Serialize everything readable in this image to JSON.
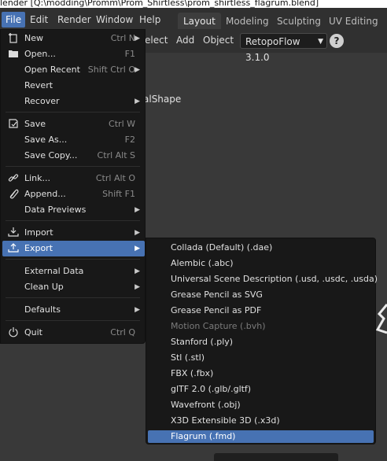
{
  "window": {
    "title": "lender [Q:\\modding\\Promm\\Prom_Shirtless\\prom_shirtless_flagrum.blend]"
  },
  "topbar": {
    "menus": [
      "File",
      "Edit",
      "Render",
      "Window",
      "Help"
    ],
    "workspaces": [
      "Layout",
      "Modeling",
      "Sculpting",
      "UV Editing"
    ]
  },
  "viewport_header": {
    "items": [
      "elect",
      "Add",
      "Object"
    ],
    "addon_dropdown": "RetopoFlow 3.1.0",
    "help_glyph": "?"
  },
  "viewport": {
    "object_label": "alShape"
  },
  "file_menu": {
    "items": [
      {
        "label": "New",
        "shortcut": "Ctrl N",
        "icon": "new-file-icon",
        "submenu": true
      },
      {
        "label": "Open...",
        "shortcut": "F1",
        "icon": "folder-icon"
      },
      {
        "label": "Open Recent",
        "shortcut": "Shift Ctrl O",
        "submenu": true
      },
      {
        "label": "Revert",
        "shortcut": ""
      },
      {
        "label": "Recover",
        "shortcut": "",
        "submenu": true
      },
      {
        "label": "Save",
        "shortcut": "Ctrl W",
        "icon": "save-icon"
      },
      {
        "label": "Save As...",
        "shortcut": "F2"
      },
      {
        "label": "Save Copy...",
        "shortcut": "Ctrl Alt S"
      },
      {
        "label": "Link...",
        "shortcut": "Ctrl Alt O",
        "icon": "link-icon"
      },
      {
        "label": "Append...",
        "shortcut": "Shift F1",
        "icon": "append-icon"
      },
      {
        "label": "Data Previews",
        "shortcut": "",
        "submenu": true
      },
      {
        "label": "Import",
        "shortcut": "",
        "icon": "import-icon",
        "submenu": true
      },
      {
        "label": "Export",
        "shortcut": "",
        "icon": "export-icon",
        "submenu": true,
        "highlighted": true
      },
      {
        "label": "External Data",
        "shortcut": "",
        "submenu": true
      },
      {
        "label": "Clean Up",
        "shortcut": "",
        "submenu": true
      },
      {
        "label": "Defaults",
        "shortcut": "",
        "submenu": true
      },
      {
        "label": "Quit",
        "shortcut": "Ctrl Q",
        "icon": "power-icon"
      }
    ]
  },
  "export_submenu": {
    "items": [
      {
        "label": "Collada (Default) (.dae)"
      },
      {
        "label": "Alembic (.abc)"
      },
      {
        "label": "Universal Scene Description (.usd, .usdc, .usda)"
      },
      {
        "label": "Grease Pencil as SVG"
      },
      {
        "label": "Grease Pencil as PDF"
      },
      {
        "label": "Motion Capture (.bvh)",
        "disabled": true
      },
      {
        "label": "Stanford (.ply)"
      },
      {
        "label": "Stl (.stl)"
      },
      {
        "label": "FBX (.fbx)"
      },
      {
        "label": "glTF 2.0 (.glb/.gltf)"
      },
      {
        "label": "Wavefront (.obj)"
      },
      {
        "label": "X3D Extensible 3D (.x3d)"
      },
      {
        "label": "Flagrum (.fmd)",
        "highlighted": true
      }
    ]
  },
  "colors": {
    "accent": "#4772b3",
    "menu_bg": "#181818",
    "viewport_bg": "#393939"
  }
}
